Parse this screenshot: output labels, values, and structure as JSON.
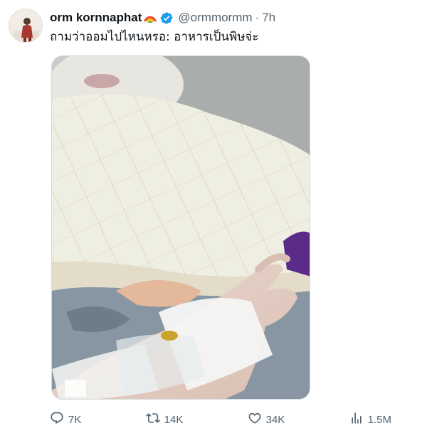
{
  "user": {
    "display_name": "orm kornnaphat",
    "display_emoji": "rainbow-icon",
    "verified_icon": "verified-badge-icon",
    "handle": "@ormmormm",
    "separator": "·",
    "time": "7h"
  },
  "tweet": {
    "text": "ถามว่าออมไปไหนหรอ: อาหารเป็นพิษจ่ะ",
    "media_alt": "hospital-bed-iv-photo"
  },
  "actions": {
    "reply": {
      "icon": "reply-icon",
      "count": "7K"
    },
    "retweet": {
      "icon": "retweet-icon",
      "count": "14K"
    },
    "like": {
      "icon": "heart-icon",
      "count": "34K"
    },
    "views": {
      "icon": "views-icon",
      "count": "1.5M"
    }
  },
  "colors": {
    "text": "#0f1419",
    "secondary": "#536471",
    "verified": "#1d9bf0"
  }
}
